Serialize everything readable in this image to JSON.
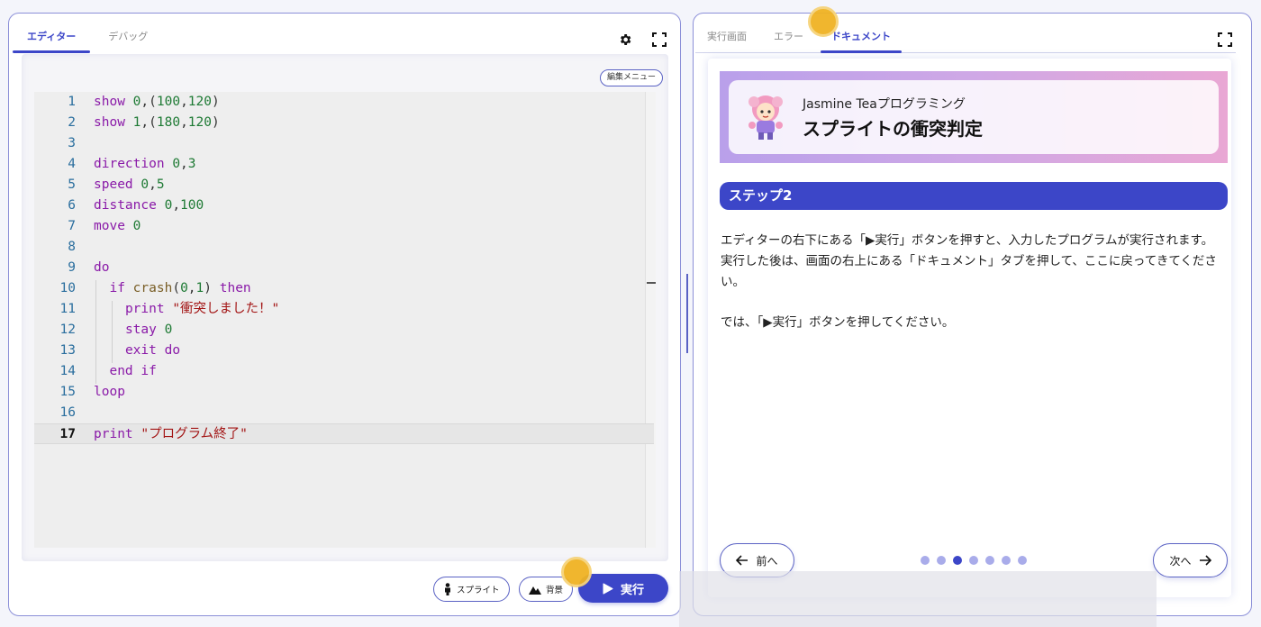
{
  "editor_panel": {
    "tabs": [
      {
        "label": "エディター",
        "active": true
      },
      {
        "label": "デバッグ",
        "active": false
      }
    ],
    "edit_menu_label": "編集メニュー",
    "current_line": 17,
    "code_lines": [
      "show 0,(100,120)",
      "show 1,(180,120)",
      "",
      "direction 0,3",
      "speed 0,5",
      "distance 0,100",
      "move 0",
      "",
      "do",
      "  if crash(0,1) then",
      "    print \"衝突しました！\"",
      "    stay 0",
      "    exit do",
      "  end if",
      "loop",
      "",
      "print \"プログラム終了\""
    ],
    "line_numbers": [
      "1",
      "2",
      "3",
      "4",
      "5",
      "6",
      "7",
      "8",
      "9",
      "10",
      "11",
      "12",
      "13",
      "14",
      "15",
      "16",
      "17"
    ],
    "sprite_button_label": "スプライト",
    "background_button_label": "背景",
    "run_button_label": "実行"
  },
  "doc_panel": {
    "tabs": [
      {
        "label": "実行画面",
        "active": false
      },
      {
        "label": "エラー",
        "active": false
      },
      {
        "label": "ドキュメント",
        "active": true
      }
    ],
    "banner_subtitle": "Jasmine Teaプログラミング",
    "banner_title": "スプライトの衝突判定",
    "step_title": "ステップ2",
    "paragraphs": [
      "エディターの右下にある「▶実行」ボタンを押すと、入力したプログラムが実行されます。実行した後は、画面の右上にある「ドキュメント」タブを押して、ここに戻ってきてください。",
      "では、「▶実行」ボタンを押してください。"
    ],
    "prev_label": "前へ",
    "next_label": "次へ",
    "page_count": 7,
    "current_page": 3
  },
  "icons": {
    "settings": "gear-icon",
    "fullscreen": "fullscreen-icon",
    "sprite": "person-icon",
    "background": "mountain-icon",
    "run": "play-icon",
    "prev": "arrow-left-icon",
    "next": "arrow-right-icon"
  },
  "colors": {
    "accent": "#3c46c8",
    "keyword": "#8a1aa8",
    "number": "#1e7a34",
    "string": "#a31515",
    "line_number": "#2a6e9e",
    "click_marker": "#f0b323"
  }
}
